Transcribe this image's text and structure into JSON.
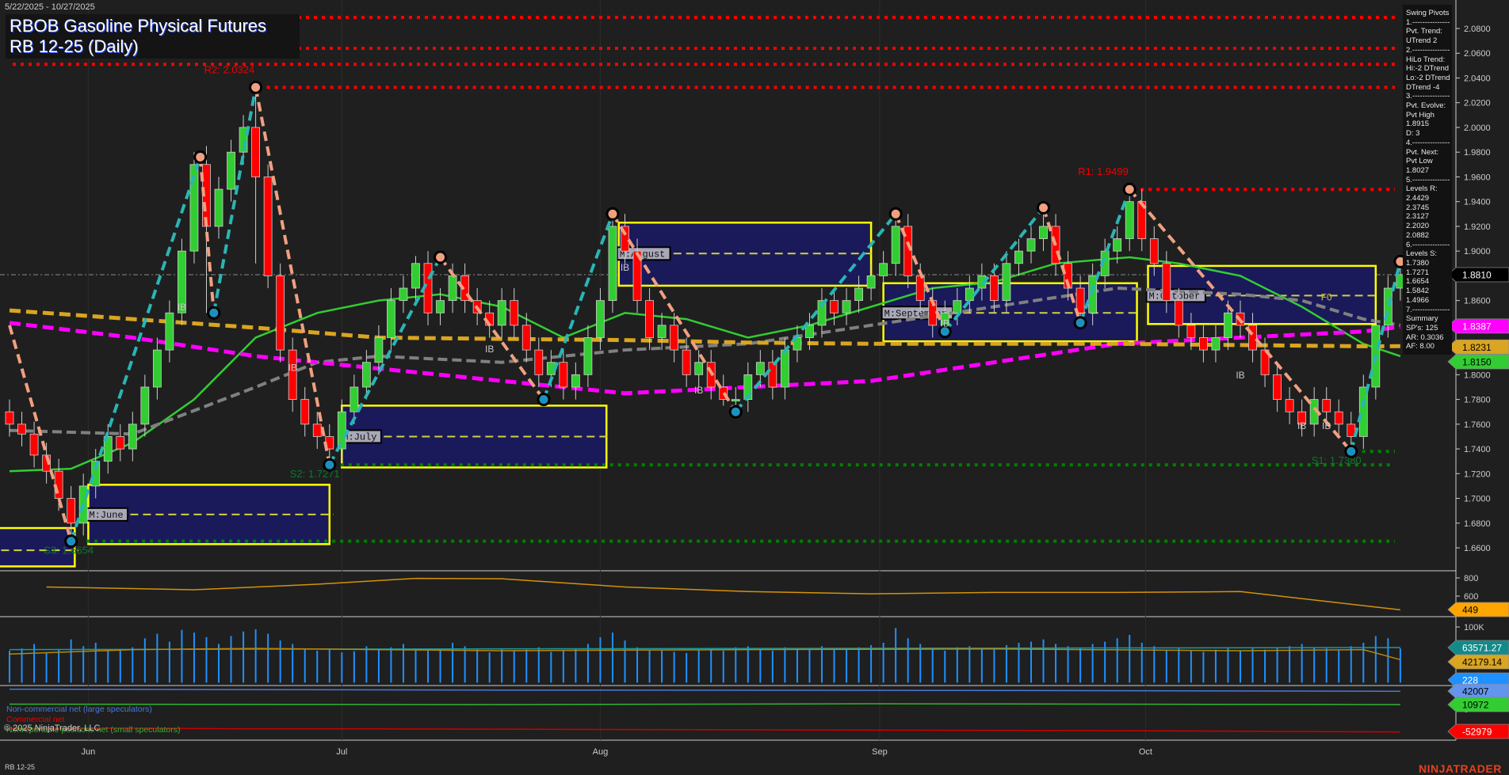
{
  "header": {
    "date_range": "5/22/2025 - 10/27/2025",
    "title": "RBOB Gasoline Physical Futures",
    "subtitle": "RB 12-25 (Daily)"
  },
  "swing_pivots": [
    "Swing Pivots",
    "1.---------------",
    "Pvt. Trend:",
    "UTrend 2",
    "2.---------------",
    "HiLo Trend:",
    "Hi:-2 DTrend",
    "Lo:-2 DTrend",
    "DTrend -4",
    "3.---------------",
    "Pvt. Evolve:",
    "Pvt High",
    "1.8915",
    "D: 3",
    "4.---------------",
    "Pvt. Next:",
    "Pvt Low",
    "1.8027",
    "5.---------------",
    "Levels R:",
    "2.4429",
    "2.3745",
    "2.3127",
    "2.2020",
    "2.0882",
    "6.---------------",
    "Levels S:",
    "1.7380",
    "1.7271",
    "1.6654",
    "1.5842",
    "1.4966",
    "7.---------------",
    "Summary",
    "SP's: 125",
    "AR: 0.3036",
    "AF: 8.00"
  ],
  "legend": {
    "noncommercial": "Non-commercial net (large speculators)",
    "commercial": "Commercial net",
    "nonreportable": "Nonreportable positions net (small speculators)",
    "copyright": "© 2025 NinjaTrader, LLC"
  },
  "footer": {
    "instrument": "RB 12-25",
    "logo": "NINJATRADER"
  },
  "colors": {
    "up": "#32cd32",
    "down": "#ff0000",
    "background": "#1f1f1f",
    "resistance": "#ff0000",
    "support": "#008000",
    "box_fill": "#1a1a5a",
    "box_border": "#ffff00",
    "zig_up": "#2ab5b5",
    "zig_down": "#f0a080"
  },
  "chart_data": {
    "type": "candlestick",
    "title": "RBOB Gasoline Physical Futures RB 12-25 (Daily)",
    "ylim": [
      1.645,
      2.095
    ],
    "y_ticks": [
      "2.0800",
      "2.0600",
      "2.0400",
      "2.0200",
      "2.0000",
      "1.9800",
      "1.9600",
      "1.9400",
      "1.9200",
      "1.9000",
      "1.8600",
      "1.8000",
      "1.7800",
      "1.7600",
      "1.7400",
      "1.7200",
      "1.7000",
      "1.6800",
      "1.6600"
    ],
    "x_ticks": [
      {
        "label": "Jun",
        "bar": 6.4
      },
      {
        "label": "Jul",
        "bar": 27
      },
      {
        "label": "Aug",
        "bar": 48
      },
      {
        "label": "Sep",
        "bar": 70.7
      },
      {
        "label": "Oct",
        "bar": 92.3
      }
    ],
    "open": [
      1.77,
      1.76,
      1.752,
      1.735,
      1.722,
      1.7,
      1.68,
      1.71,
      1.73,
      1.75,
      1.74,
      1.76,
      1.79,
      1.82,
      1.85,
      1.9,
      1.97,
      1.92,
      1.95,
      1.98,
      2.0,
      1.96,
      1.88,
      1.82,
      1.78,
      1.76,
      1.75,
      1.74,
      1.77,
      1.79,
      1.81,
      1.83,
      1.86,
      1.87,
      1.89,
      1.85,
      1.86,
      1.88,
      1.86,
      1.85,
      1.84,
      1.86,
      1.84,
      1.82,
      1.8,
      1.81,
      1.79,
      1.8,
      1.83,
      1.86,
      1.92,
      1.9,
      1.86,
      1.83,
      1.84,
      1.82,
      1.8,
      1.81,
      1.79,
      1.78,
      1.78,
      1.8,
      1.81,
      1.79,
      1.82,
      1.83,
      1.84,
      1.86,
      1.85,
      1.86,
      1.87,
      1.88,
      1.89,
      1.92,
      1.88,
      1.86,
      1.84,
      1.85,
      1.86,
      1.87,
      1.88,
      1.86,
      1.89,
      1.9,
      1.91,
      1.92,
      1.89,
      1.87,
      1.85,
      1.88,
      1.9,
      1.91,
      1.94,
      1.91,
      1.89,
      1.86,
      1.84,
      1.83,
      1.82,
      1.83,
      1.85,
      1.84,
      1.82,
      1.8,
      1.78,
      1.77,
      1.76,
      1.78,
      1.77,
      1.76,
      1.75,
      1.79,
      1.84,
      1.87
    ],
    "high": [
      1.78,
      1.77,
      1.762,
      1.745,
      1.732,
      1.71,
      1.72,
      1.74,
      1.76,
      1.76,
      1.77,
      1.8,
      1.83,
      1.86,
      1.91,
      1.98,
      1.985,
      1.96,
      1.99,
      2.01,
      2.032,
      1.97,
      1.89,
      1.83,
      1.79,
      1.77,
      1.76,
      1.78,
      1.8,
      1.82,
      1.84,
      1.87,
      1.88,
      1.896,
      1.9,
      1.87,
      1.89,
      1.89,
      1.87,
      1.86,
      1.87,
      1.87,
      1.85,
      1.83,
      1.82,
      1.82,
      1.81,
      1.84,
      1.87,
      1.93,
      1.93,
      1.91,
      1.87,
      1.85,
      1.85,
      1.83,
      1.82,
      1.82,
      1.8,
      1.79,
      1.81,
      1.82,
      1.82,
      1.83,
      1.84,
      1.85,
      1.87,
      1.87,
      1.87,
      1.88,
      1.89,
      1.9,
      1.93,
      1.93,
      1.89,
      1.87,
      1.86,
      1.87,
      1.88,
      1.89,
      1.89,
      1.9,
      1.91,
      1.92,
      1.935,
      1.93,
      1.9,
      1.88,
      1.89,
      1.91,
      1.92,
      1.95,
      1.95,
      1.92,
      1.9,
      1.87,
      1.85,
      1.84,
      1.84,
      1.86,
      1.86,
      1.85,
      1.83,
      1.81,
      1.79,
      1.78,
      1.79,
      1.79,
      1.78,
      1.77,
      1.8,
      1.85,
      1.88,
      1.891
    ],
    "low": [
      1.75,
      1.742,
      1.725,
      1.712,
      1.69,
      1.665,
      1.67,
      1.7,
      1.72,
      1.73,
      1.73,
      1.75,
      1.78,
      1.81,
      1.84,
      1.89,
      1.85,
      1.91,
      1.94,
      1.97,
      1.89,
      1.87,
      1.81,
      1.77,
      1.75,
      1.74,
      1.727,
      1.73,
      1.76,
      1.78,
      1.8,
      1.82,
      1.85,
      1.86,
      1.84,
      1.84,
      1.85,
      1.85,
      1.84,
      1.83,
      1.83,
      1.83,
      1.81,
      1.79,
      1.79,
      1.78,
      1.78,
      1.79,
      1.82,
      1.85,
      1.89,
      1.85,
      1.82,
      1.82,
      1.81,
      1.79,
      1.79,
      1.78,
      1.775,
      1.77,
      1.77,
      1.79,
      1.78,
      1.78,
      1.81,
      1.82,
      1.83,
      1.84,
      1.84,
      1.85,
      1.86,
      1.87,
      1.88,
      1.87,
      1.85,
      1.83,
      1.835,
      1.84,
      1.85,
      1.86,
      1.85,
      1.85,
      1.88,
      1.89,
      1.9,
      1.88,
      1.86,
      1.842,
      1.84,
      1.87,
      1.89,
      1.9,
      1.9,
      1.88,
      1.85,
      1.83,
      1.82,
      1.81,
      1.81,
      1.82,
      1.83,
      1.81,
      1.79,
      1.77,
      1.76,
      1.75,
      1.75,
      1.76,
      1.75,
      1.738,
      1.74,
      1.78,
      1.83,
      1.86
    ],
    "close": [
      1.76,
      1.752,
      1.735,
      1.722,
      1.7,
      1.68,
      1.71,
      1.73,
      1.75,
      1.74,
      1.76,
      1.79,
      1.82,
      1.85,
      1.9,
      1.97,
      1.92,
      1.95,
      1.98,
      2.0,
      1.96,
      1.88,
      1.82,
      1.78,
      1.76,
      1.75,
      1.74,
      1.77,
      1.79,
      1.81,
      1.83,
      1.86,
      1.87,
      1.89,
      1.85,
      1.86,
      1.88,
      1.86,
      1.85,
      1.84,
      1.86,
      1.84,
      1.82,
      1.8,
      1.81,
      1.79,
      1.8,
      1.83,
      1.86,
      1.92,
      1.9,
      1.86,
      1.83,
      1.84,
      1.82,
      1.8,
      1.81,
      1.79,
      1.78,
      1.78,
      1.8,
      1.81,
      1.79,
      1.82,
      1.83,
      1.84,
      1.86,
      1.85,
      1.86,
      1.87,
      1.88,
      1.89,
      1.92,
      1.88,
      1.86,
      1.84,
      1.85,
      1.86,
      1.87,
      1.88,
      1.86,
      1.89,
      1.9,
      1.91,
      1.92,
      1.89,
      1.87,
      1.85,
      1.88,
      1.9,
      1.91,
      1.94,
      1.91,
      1.89,
      1.86,
      1.84,
      1.83,
      1.82,
      1.83,
      1.85,
      1.84,
      1.82,
      1.8,
      1.78,
      1.77,
      1.76,
      1.78,
      1.77,
      1.76,
      1.75,
      1.79,
      1.84,
      1.87,
      1.881
    ],
    "moving_averages": [
      {
        "name": "fast",
        "color": "#32cd32",
        "points": [
          [
            0,
            1.722
          ],
          [
            5,
            1.724
          ],
          [
            10,
            1.745
          ],
          [
            15,
            1.78
          ],
          [
            20,
            1.83
          ],
          [
            25,
            1.85
          ],
          [
            30,
            1.86
          ],
          [
            35,
            1.865
          ],
          [
            40,
            1.855
          ],
          [
            45,
            1.83
          ],
          [
            50,
            1.85
          ],
          [
            55,
            1.845
          ],
          [
            60,
            1.83
          ],
          [
            65,
            1.84
          ],
          [
            70,
            1.855
          ],
          [
            75,
            1.87
          ],
          [
            80,
            1.875
          ],
          [
            85,
            1.89
          ],
          [
            91,
            1.895
          ],
          [
            95,
            1.89
          ],
          [
            100,
            1.88
          ],
          [
            105,
            1.855
          ],
          [
            110,
            1.825
          ],
          [
            113,
            1.815
          ]
        ],
        "last": "1.8150"
      },
      {
        "name": "mid",
        "color": "#808080",
        "points": [
          [
            0,
            1.755
          ],
          [
            10,
            1.752
          ],
          [
            20,
            1.79
          ],
          [
            25,
            1.81
          ],
          [
            30,
            1.815
          ],
          [
            40,
            1.81
          ],
          [
            50,
            1.82
          ],
          [
            60,
            1.825
          ],
          [
            70,
            1.84
          ],
          [
            80,
            1.855
          ],
          [
            90,
            1.87
          ],
          [
            100,
            1.865
          ],
          [
            105,
            1.86
          ],
          [
            110,
            1.845
          ],
          [
            113,
            1.84
          ]
        ]
      },
      {
        "name": "magenta",
        "color": "#ff00ff",
        "points": [
          [
            0,
            1.842
          ],
          [
            10,
            1.83
          ],
          [
            20,
            1.815
          ],
          [
            30,
            1.805
          ],
          [
            40,
            1.795
          ],
          [
            50,
            1.785
          ],
          [
            60,
            1.79
          ],
          [
            70,
            1.795
          ],
          [
            80,
            1.81
          ],
          [
            90,
            1.825
          ],
          [
            100,
            1.83
          ],
          [
            110,
            1.835
          ],
          [
            113,
            1.8387
          ]
        ],
        "last": "1.8387"
      },
      {
        "name": "orange",
        "color": "#daa520",
        "points": [
          [
            0,
            1.852
          ],
          [
            10,
            1.845
          ],
          [
            20,
            1.838
          ],
          [
            30,
            1.83
          ],
          [
            40,
            1.829
          ],
          [
            50,
            1.828
          ],
          [
            60,
            1.826
          ],
          [
            70,
            1.825
          ],
          [
            80,
            1.825
          ],
          [
            90,
            1.825
          ],
          [
            100,
            1.824
          ],
          [
            110,
            1.823
          ],
          [
            113,
            1.8231
          ]
        ],
        "last": "1.8231"
      }
    ],
    "last_price": "1.8810",
    "zigzag": [
      [
        0,
        1.84
      ],
      [
        5,
        1.6654
      ],
      [
        15.5,
        1.976
      ],
      [
        16.6,
        1.85
      ],
      [
        20,
        2.0324
      ],
      [
        26,
        1.7271
      ],
      [
        35,
        1.895
      ],
      [
        43.4,
        1.78
      ],
      [
        49,
        1.93
      ],
      [
        59,
        1.77
      ],
      [
        72,
        1.93
      ],
      [
        76,
        1.835
      ],
      [
        84,
        1.935
      ],
      [
        87,
        1.842
      ],
      [
        91,
        1.9499
      ],
      [
        109,
        1.738
      ],
      [
        113,
        1.8915
      ]
    ],
    "levels": [
      {
        "label": "",
        "price": 2.089,
        "type": "R",
        "from": 0
      },
      {
        "label": "",
        "price": 2.064,
        "type": "R",
        "from": 0
      },
      {
        "label": "",
        "price": 2.051,
        "type": "R",
        "from": 0
      },
      {
        "label": "R2: 2.0324",
        "price": 2.0324,
        "type": "R",
        "from": 20
      },
      {
        "label": "R1: 1.9499",
        "price": 1.9499,
        "type": "R",
        "from": 91
      },
      {
        "label": "S1: 1.7380",
        "price": 1.738,
        "type": "S",
        "from": 109
      },
      {
        "label": "S2: 1.7271",
        "price": 1.7271,
        "type": "S",
        "from": 26
      },
      {
        "label": "S3: 1.6654",
        "price": 1.6654,
        "type": "S",
        "from": 6
      }
    ],
    "month_boxes": [
      {
        "label": "",
        "from": -1,
        "to": 5.3,
        "top": 1.676,
        "bottom": 1.645,
        "mid": 1.658
      },
      {
        "label": "M:June",
        "from": 6.4,
        "to": 26,
        "top": 1.711,
        "bottom": 1.663,
        "mid": 1.687
      },
      {
        "label": "M:July",
        "from": 27,
        "to": 48.5,
        "top": 1.775,
        "bottom": 1.725,
        "mid": 1.75
      },
      {
        "label": "M:August",
        "from": 49.5,
        "to": 70,
        "top": 1.923,
        "bottom": 1.872,
        "mid": 1.898
      },
      {
        "label": "M:September",
        "from": 71,
        "to": 91.6,
        "top": 1.874,
        "bottom": 1.827,
        "mid": 1.85
      },
      {
        "label": "M:October",
        "from": 92.5,
        "to": 111,
        "top": 1.888,
        "bottom": 1.841,
        "mid": 1.864
      }
    ],
    "annotations": [
      {
        "text": "F0",
        "bar": 107,
        "price": 1.86
      },
      {
        "text": "IB",
        "bar": 14,
        "price": 1.852
      },
      {
        "text": "IB",
        "bar": 23,
        "price": 1.803
      },
      {
        "text": "IB",
        "bar": 39,
        "price": 1.818
      },
      {
        "text": "IB",
        "bar": 50,
        "price": 1.884
      },
      {
        "text": "IB",
        "bar": 56,
        "price": 1.785
      },
      {
        "text": "IB",
        "bar": 76,
        "price": 1.839
      },
      {
        "text": "IB",
        "bar": 100,
        "price": 1.797
      },
      {
        "text": "IB",
        "bar": 105,
        "price": 1.756
      },
      {
        "text": "IB",
        "bar": 107,
        "price": 1.756
      }
    ],
    "panel1": {
      "ticks": [
        "800",
        "600"
      ],
      "last": "449",
      "points": [
        [
          3,
          700
        ],
        [
          15,
          670
        ],
        [
          25,
          730
        ],
        [
          33,
          795
        ],
        [
          40,
          790
        ],
        [
          50,
          700
        ],
        [
          60,
          650
        ],
        [
          70,
          625
        ],
        [
          80,
          640
        ],
        [
          90,
          640
        ],
        [
          100,
          650
        ],
        [
          113,
          449
        ]
      ]
    },
    "panel2": {
      "ticks": [
        "100K"
      ],
      "last_teal": "63571.27",
      "last_orange": "42179.14",
      "last_bar": "228",
      "volume_k": [
        58,
        62,
        70,
        55,
        60,
        78,
        66,
        72,
        60,
        58,
        64,
        80,
        88,
        74,
        95,
        90,
        82,
        70,
        84,
        92,
        96,
        88,
        76,
        70,
        60,
        58,
        62,
        55,
        57,
        66,
        60,
        64,
        70,
        62,
        58,
        60,
        72,
        66,
        60,
        55,
        62,
        58,
        60,
        64,
        56,
        58,
        62,
        70,
        82,
        90,
        76,
        64,
        60,
        58,
        56,
        54,
        60,
        62,
        58,
        64,
        66,
        60,
        58,
        64,
        62,
        60,
        66,
        62,
        60,
        64,
        68,
        72,
        98,
        80,
        70,
        62,
        58,
        64,
        66,
        62,
        60,
        68,
        72,
        74,
        78,
        70,
        66,
        62,
        70,
        74,
        80,
        86,
        72,
        66,
        60,
        62,
        58,
        56,
        60,
        64,
        58,
        62,
        60,
        64,
        66,
        70,
        64,
        62,
        60,
        66,
        72,
        84,
        80,
        62
      ],
      "teal": [
        [
          0,
          60
        ],
        [
          113,
          63.6
        ]
      ],
      "orange": [
        [
          0,
          52
        ],
        [
          10,
          60
        ],
        [
          20,
          62
        ],
        [
          30,
          60
        ],
        [
          40,
          58
        ],
        [
          60,
          60
        ],
        [
          80,
          61
        ],
        [
          100,
          58
        ],
        [
          110,
          60
        ],
        [
          113,
          42.2
        ]
      ]
    },
    "panel3": {
      "ticks": [
        "0"
      ],
      "noncommercial": "42007",
      "nonreportable": "10972",
      "commercial": "-52979",
      "blue": [
        [
          0,
          47
        ],
        [
          40,
          45
        ],
        [
          80,
          44
        ],
        [
          113,
          42
        ]
      ],
      "green": [
        [
          0,
          12
        ],
        [
          40,
          11
        ],
        [
          70,
          13
        ],
        [
          113,
          11
        ]
      ],
      "red": [
        [
          0,
          -44
        ],
        [
          10,
          -44
        ],
        [
          20,
          -46
        ],
        [
          30,
          -46
        ],
        [
          60,
          -48
        ],
        [
          90,
          -50
        ],
        [
          113,
          -53
        ]
      ]
    }
  }
}
